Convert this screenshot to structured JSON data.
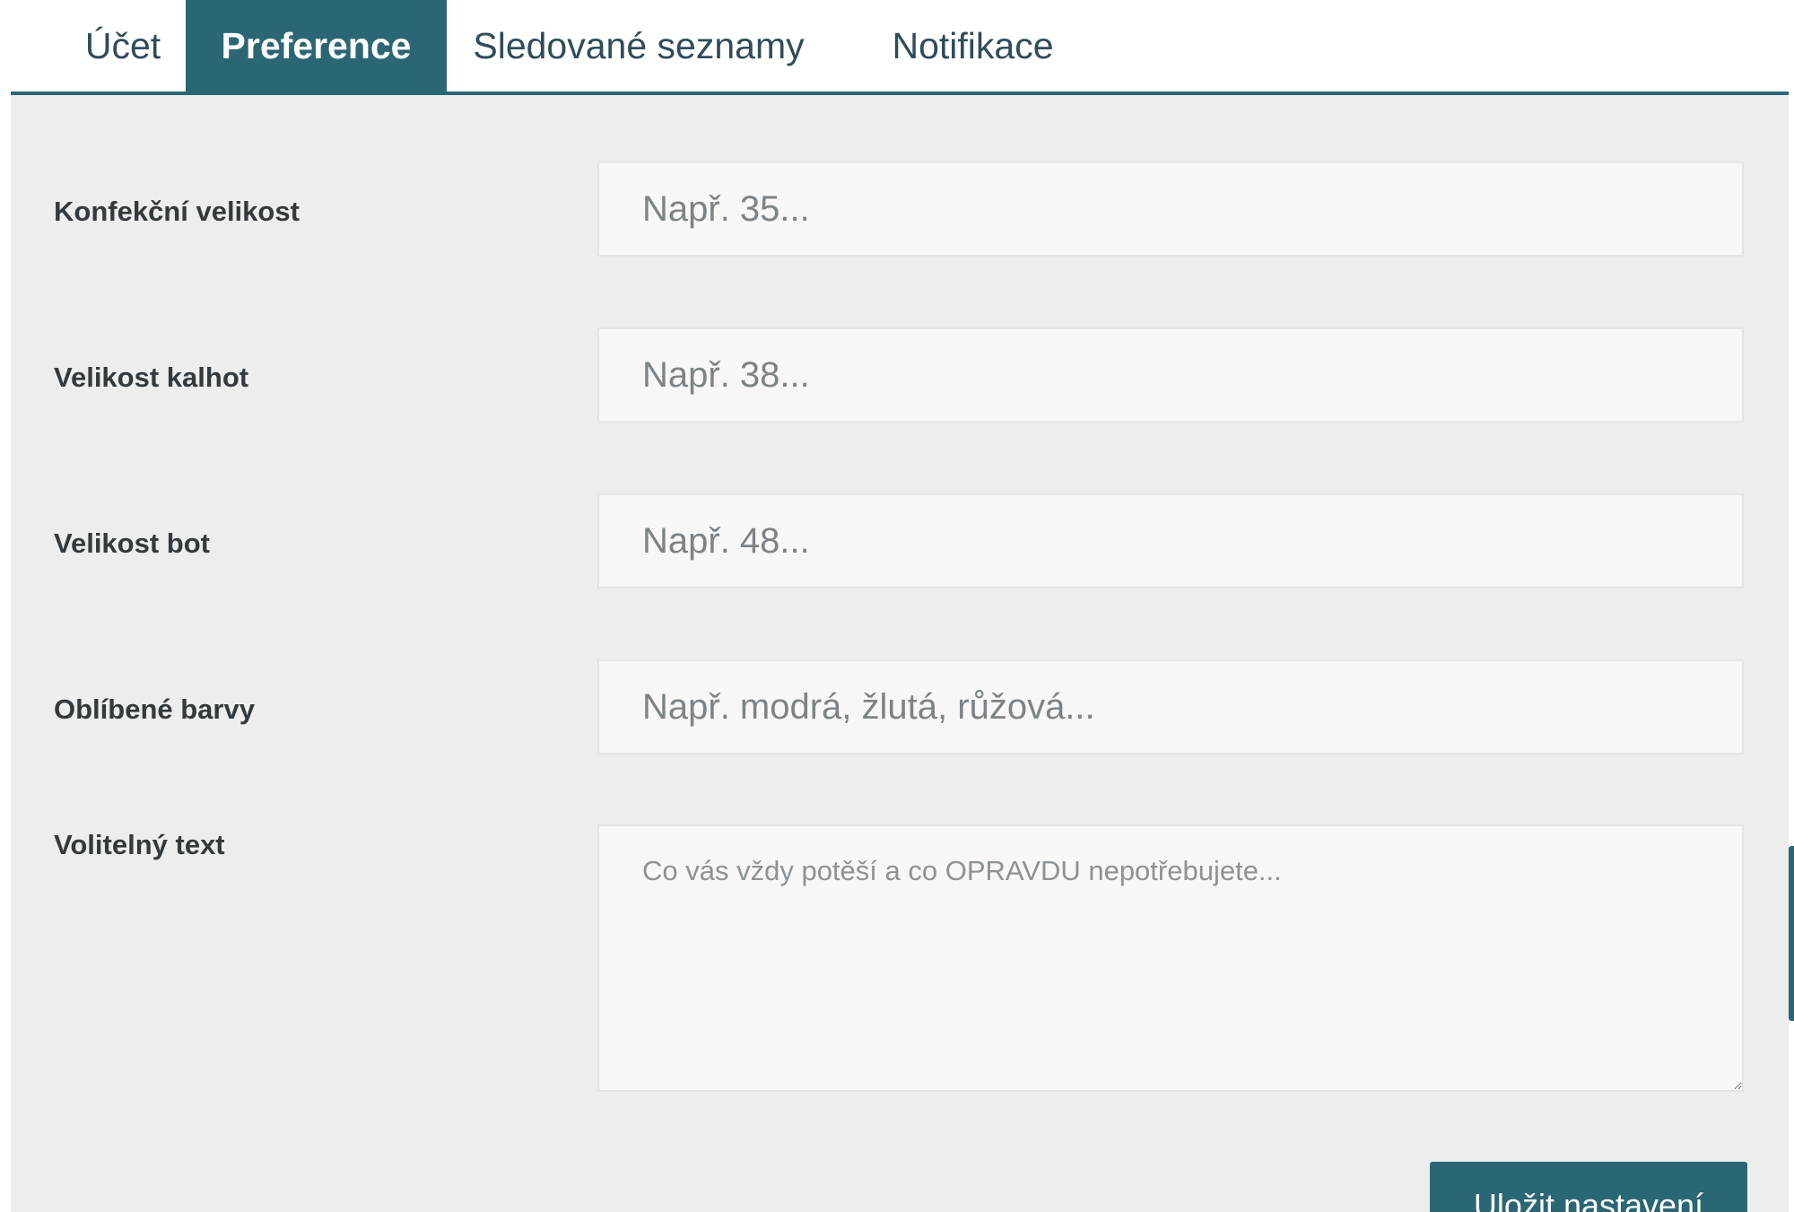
{
  "tabs": [
    {
      "label": "Účet",
      "active": false
    },
    {
      "label": "Preference",
      "active": true
    },
    {
      "label": "Sledované seznamy",
      "active": false
    },
    {
      "label": "Notifikace",
      "active": false
    }
  ],
  "form": {
    "fields": [
      {
        "label": "Konfekční velikost",
        "value": "",
        "placeholder": "Např. 35..."
      },
      {
        "label": "Velikost kalhot",
        "value": "",
        "placeholder": "Např. 38..."
      },
      {
        "label": "Velikost bot",
        "value": "",
        "placeholder": "Např. 48..."
      },
      {
        "label": "Oblíbené barvy",
        "value": "",
        "placeholder": "Např. modrá, žlutá, růžová..."
      }
    ],
    "textarea": {
      "label": "Volitelný text",
      "value": "",
      "placeholder": "Co vás vždy potěší a co OPRAVDU nepotřebujete..."
    },
    "save_label": "Uložit nastavení"
  },
  "colors": {
    "accent": "#2b6675",
    "panel_bg": "#eceeee",
    "field_bg": "#f7f7f8"
  }
}
